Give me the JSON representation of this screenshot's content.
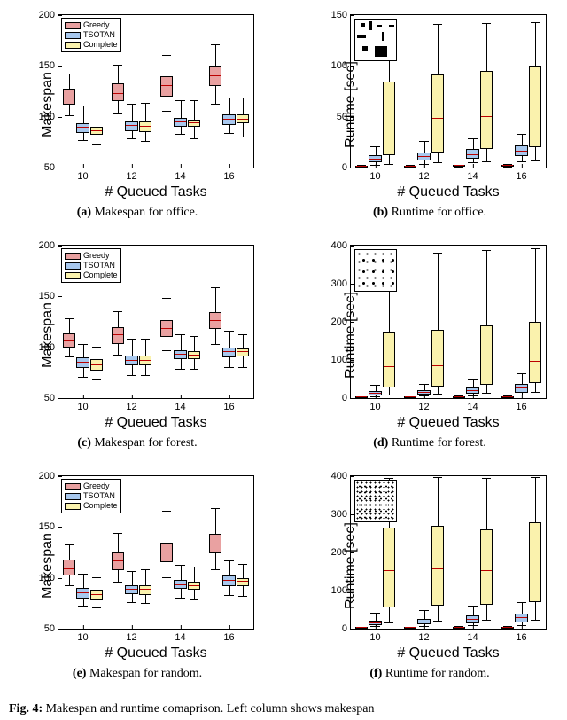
{
  "colors": {
    "greedy": "#e9a1a1",
    "tsotan": "#a8c8ee",
    "complete": "#faf2ad"
  },
  "legend": {
    "greedy": "Greedy",
    "tsotan": "TSOTAN",
    "complete": "Complete"
  },
  "xlabel": "# Queued Tasks",
  "xticks": [
    "10",
    "12",
    "14",
    "16"
  ],
  "captions": {
    "a": "Makespan for office.",
    "b": "Runtime for office.",
    "c": "Makespan for forest.",
    "d": "Runtime for forest.",
    "e": "Makespan for random.",
    "f": "Runtime for random."
  },
  "caption_labels": {
    "a": "(a)",
    "b": "(b)",
    "c": "(c)",
    "d": "(d)",
    "e": "(e)",
    "f": "(f)"
  },
  "fig_label": "Fig. 4:",
  "fig_text": "Makespan and runtime comaprison. Left column shows makespan",
  "chart_data": [
    {
      "id": "a",
      "type": "box",
      "title": "Makespan for office",
      "ylabel": "Makespan",
      "ylim": [
        50,
        200
      ],
      "yticks": [
        50,
        100,
        150,
        200
      ],
      "categories": [
        10,
        12,
        14,
        16
      ],
      "series": [
        {
          "name": "Greedy",
          "color": "#e9a1a1",
          "boxes": [
            {
              "min": 101,
              "q1": 112,
              "med": 118,
              "q3": 128,
              "max": 142
            },
            {
              "min": 102,
              "q1": 115,
              "med": 122,
              "q3": 133,
              "max": 150
            },
            {
              "min": 105,
              "q1": 120,
              "med": 130,
              "q3": 140,
              "max": 160
            },
            {
              "min": 112,
              "q1": 130,
              "med": 140,
              "q3": 150,
              "max": 170
            }
          ]
        },
        {
          "name": "TSOTAN",
          "color": "#a8c8ee",
          "boxes": [
            {
              "min": 76,
              "q1": 84,
              "med": 89,
              "q3": 94,
              "max": 110
            },
            {
              "min": 78,
              "q1": 86,
              "med": 91,
              "q3": 95,
              "max": 112
            },
            {
              "min": 82,
              "q1": 90,
              "med": 95,
              "q3": 99,
              "max": 115
            },
            {
              "min": 83,
              "q1": 92,
              "med": 97,
              "q3": 102,
              "max": 118
            }
          ]
        },
        {
          "name": "Complete",
          "color": "#faf2ad",
          "boxes": [
            {
              "min": 73,
              "q1": 82,
              "med": 86,
              "q3": 90,
              "max": 103
            },
            {
              "min": 75,
              "q1": 85,
              "med": 90,
              "q3": 95,
              "max": 113
            },
            {
              "min": 78,
              "q1": 90,
              "med": 94,
              "q3": 97,
              "max": 115
            },
            {
              "min": 80,
              "q1": 94,
              "med": 97,
              "q3": 102,
              "max": 118
            }
          ]
        }
      ]
    },
    {
      "id": "b",
      "type": "box",
      "title": "Runtime for office",
      "ylabel": "Runtime [sec]",
      "ylim": [
        0,
        150
      ],
      "yticks": [
        0,
        50,
        100,
        150
      ],
      "categories": [
        10,
        12,
        14,
        16
      ],
      "inset": "office",
      "series": [
        {
          "name": "Greedy",
          "color": "#e9a1a1",
          "boxes": [
            {
              "min": 0.2,
              "q1": 0.3,
              "med": 0.5,
              "q3": 0.8,
              "max": 1.5
            },
            {
              "min": 0.2,
              "q1": 0.4,
              "med": 0.6,
              "q3": 0.9,
              "max": 1.8
            },
            {
              "min": 0.3,
              "q1": 0.5,
              "med": 0.7,
              "q3": 1.1,
              "max": 2.0
            },
            {
              "min": 0.3,
              "q1": 0.5,
              "med": 0.8,
              "q3": 1.3,
              "max": 2.2
            }
          ]
        },
        {
          "name": "TSOTAN",
          "color": "#a8c8ee",
          "boxes": [
            {
              "min": 2,
              "q1": 5,
              "med": 8,
              "q3": 12,
              "max": 20
            },
            {
              "min": 3,
              "q1": 7,
              "med": 10,
              "q3": 15,
              "max": 25
            },
            {
              "min": 4,
              "q1": 9,
              "med": 12,
              "q3": 18,
              "max": 28
            },
            {
              "min": 5,
              "q1": 11,
              "med": 16,
              "q3": 22,
              "max": 32
            }
          ]
        },
        {
          "name": "Complete",
          "color": "#faf2ad",
          "boxes": [
            {
              "min": 3,
              "q1": 12,
              "med": 45,
              "q3": 85,
              "max": 133
            },
            {
              "min": 4,
              "q1": 15,
              "med": 48,
              "q3": 92,
              "max": 140
            },
            {
              "min": 5,
              "q1": 18,
              "med": 50,
              "q3": 95,
              "max": 141
            },
            {
              "min": 6,
              "q1": 20,
              "med": 53,
              "q3": 100,
              "max": 142
            }
          ]
        }
      ]
    },
    {
      "id": "c",
      "type": "box",
      "title": "Makespan for forest",
      "ylabel": "Makespan",
      "ylim": [
        50,
        200
      ],
      "yticks": [
        50,
        100,
        150,
        200
      ],
      "categories": [
        10,
        12,
        14,
        16
      ],
      "series": [
        {
          "name": "Greedy",
          "color": "#e9a1a1",
          "boxes": [
            {
              "min": 90,
              "q1": 100,
              "med": 106,
              "q3": 114,
              "max": 128
            },
            {
              "min": 92,
              "q1": 103,
              "med": 112,
              "q3": 120,
              "max": 135
            },
            {
              "min": 96,
              "q1": 110,
              "med": 118,
              "q3": 127,
              "max": 148
            },
            {
              "min": 102,
              "q1": 118,
              "med": 126,
              "q3": 135,
              "max": 158
            }
          ]
        },
        {
          "name": "TSOTAN",
          "color": "#a8c8ee",
          "boxes": [
            {
              "min": 70,
              "q1": 80,
              "med": 85,
              "q3": 90,
              "max": 102
            },
            {
              "min": 72,
              "q1": 82,
              "med": 87,
              "q3": 92,
              "max": 108
            },
            {
              "min": 78,
              "q1": 88,
              "med": 93,
              "q3": 97,
              "max": 112
            },
            {
              "min": 80,
              "q1": 90,
              "med": 95,
              "q3": 100,
              "max": 115
            }
          ]
        },
        {
          "name": "Complete",
          "color": "#faf2ad",
          "boxes": [
            {
              "min": 68,
              "q1": 77,
              "med": 82,
              "q3": 88,
              "max": 100
            },
            {
              "min": 72,
              "q1": 82,
              "med": 87,
              "q3": 92,
              "max": 108
            },
            {
              "min": 78,
              "q1": 88,
              "med": 92,
              "q3": 96,
              "max": 110
            },
            {
              "min": 80,
              "q1": 91,
              "med": 95,
              "q3": 99,
              "max": 112
            }
          ]
        }
      ]
    },
    {
      "id": "d",
      "type": "box",
      "title": "Runtime for forest",
      "ylabel": "Runtime [sec]",
      "ylim": [
        0,
        400
      ],
      "yticks": [
        0,
        100,
        200,
        300,
        400
      ],
      "categories": [
        10,
        12,
        14,
        16
      ],
      "inset": "forest",
      "series": [
        {
          "name": "Greedy",
          "color": "#e9a1a1",
          "boxes": [
            {
              "min": 0.3,
              "q1": 0.6,
              "med": 1.0,
              "q3": 1.5,
              "max": 3
            },
            {
              "min": 0.4,
              "q1": 0.7,
              "med": 1.2,
              "q3": 1.8,
              "max": 3.5
            },
            {
              "min": 0.4,
              "q1": 0.8,
              "med": 1.3,
              "q3": 2.0,
              "max": 4
            },
            {
              "min": 0.5,
              "q1": 0.9,
              "med": 1.5,
              "q3": 2.3,
              "max": 4.5
            }
          ]
        },
        {
          "name": "TSOTAN",
          "color": "#a8c8ee",
          "boxes": [
            {
              "min": 3,
              "q1": 8,
              "med": 12,
              "q3": 18,
              "max": 32
            },
            {
              "min": 4,
              "q1": 9,
              "med": 14,
              "q3": 20,
              "max": 35
            },
            {
              "min": 5,
              "q1": 12,
              "med": 18,
              "q3": 28,
              "max": 50
            },
            {
              "min": 6,
              "q1": 15,
              "med": 24,
              "q3": 38,
              "max": 62
            }
          ]
        },
        {
          "name": "Complete",
          "color": "#faf2ad",
          "boxes": [
            {
              "min": 8,
              "q1": 28,
              "med": 80,
              "q3": 175,
              "max": 375
            },
            {
              "min": 10,
              "q1": 30,
              "med": 82,
              "q3": 180,
              "max": 380
            },
            {
              "min": 12,
              "q1": 35,
              "med": 88,
              "q3": 190,
              "max": 385
            },
            {
              "min": 15,
              "q1": 40,
              "med": 95,
              "q3": 200,
              "max": 390
            }
          ]
        }
      ]
    },
    {
      "id": "e",
      "type": "box",
      "title": "Makespan for random",
      "ylabel": "Makespan",
      "ylim": [
        50,
        200
      ],
      "yticks": [
        50,
        100,
        150,
        200
      ],
      "categories": [
        10,
        12,
        14,
        16
      ],
      "series": [
        {
          "name": "Greedy",
          "color": "#e9a1a1",
          "boxes": [
            {
              "min": 92,
              "q1": 102,
              "med": 108,
              "q3": 118,
              "max": 132
            },
            {
              "min": 95,
              "q1": 108,
              "med": 116,
              "q3": 125,
              "max": 143
            },
            {
              "min": 100,
              "q1": 115,
              "med": 125,
              "q3": 135,
              "max": 165
            },
            {
              "min": 108,
              "q1": 124,
              "med": 133,
              "q3": 143,
              "max": 168
            }
          ]
        },
        {
          "name": "TSOTAN",
          "color": "#a8c8ee",
          "boxes": [
            {
              "min": 72,
              "q1": 80,
              "med": 85,
              "q3": 90,
              "max": 103
            },
            {
              "min": 75,
              "q1": 84,
              "med": 88,
              "q3": 93,
              "max": 106
            },
            {
              "min": 80,
              "q1": 89,
              "med": 93,
              "q3": 98,
              "max": 112
            },
            {
              "min": 82,
              "q1": 92,
              "med": 97,
              "q3": 102,
              "max": 116
            }
          ]
        },
        {
          "name": "Complete",
          "color": "#faf2ad",
          "boxes": [
            {
              "min": 70,
              "q1": 78,
              "med": 83,
              "q3": 88,
              "max": 100
            },
            {
              "min": 74,
              "q1": 83,
              "med": 88,
              "q3": 93,
              "max": 108
            },
            {
              "min": 78,
              "q1": 88,
              "med": 92,
              "q3": 96,
              "max": 110
            },
            {
              "min": 81,
              "q1": 92,
              "med": 96,
              "q3": 100,
              "max": 113
            }
          ]
        }
      ]
    },
    {
      "id": "f",
      "type": "box",
      "title": "Runtime for random",
      "ylabel": "Runtime [sec]",
      "ylim": [
        0,
        400
      ],
      "yticks": [
        0,
        100,
        200,
        300,
        400
      ],
      "categories": [
        10,
        12,
        14,
        16
      ],
      "inset": "random",
      "series": [
        {
          "name": "Greedy",
          "color": "#e9a1a1",
          "boxes": [
            {
              "min": 0.3,
              "q1": 0.6,
              "med": 1.0,
              "q3": 1.6,
              "max": 3
            },
            {
              "min": 0.4,
              "q1": 0.7,
              "med": 1.2,
              "q3": 1.9,
              "max": 3.5
            },
            {
              "min": 0.4,
              "q1": 0.8,
              "med": 1.4,
              "q3": 2.2,
              "max": 4
            },
            {
              "min": 0.5,
              "q1": 1.0,
              "med": 1.6,
              "q3": 2.5,
              "max": 4.5
            }
          ]
        },
        {
          "name": "TSOTAN",
          "color": "#a8c8ee",
          "boxes": [
            {
              "min": 4,
              "q1": 9,
              "med": 14,
              "q3": 22,
              "max": 40
            },
            {
              "min": 5,
              "q1": 11,
              "med": 17,
              "q3": 26,
              "max": 46
            },
            {
              "min": 6,
              "q1": 14,
              "med": 22,
              "q3": 34,
              "max": 58
            },
            {
              "min": 7,
              "q1": 17,
              "med": 27,
              "q3": 40,
              "max": 67
            }
          ]
        },
        {
          "name": "Complete",
          "color": "#faf2ad",
          "boxes": [
            {
              "min": 15,
              "q1": 55,
              "med": 150,
              "q3": 265,
              "max": 393
            },
            {
              "min": 18,
              "q1": 60,
              "med": 155,
              "q3": 270,
              "max": 395
            },
            {
              "min": 20,
              "q1": 62,
              "med": 150,
              "q3": 260,
              "max": 393
            },
            {
              "min": 22,
              "q1": 70,
              "med": 160,
              "q3": 280,
              "max": 395
            }
          ]
        }
      ]
    }
  ]
}
